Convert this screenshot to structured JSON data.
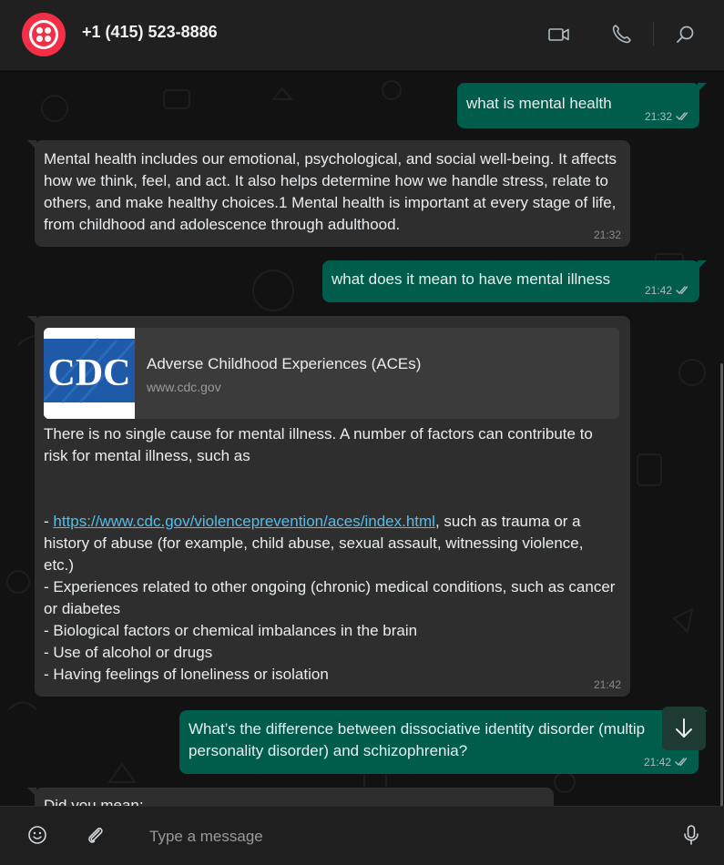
{
  "header": {
    "contact_name": "+1 (415) 523-8886",
    "icons": [
      "twilio-logo",
      "video-call-icon",
      "phone-icon",
      "search-icon"
    ]
  },
  "messages": [
    {
      "direction": "outgoing",
      "text": "what is mental health",
      "time": "21:32",
      "status": "read"
    },
    {
      "direction": "incoming",
      "text": "Mental health includes our emotional, psychological, and social well-being. It affects how we think, feel, and act. It also helps determine how we handle stress, relate to others, and make healthy choices.1 Mental health is important at every stage of life, from childhood and adolescence through adulthood.",
      "time": "21:32"
    },
    {
      "direction": "outgoing",
      "text": "what does it mean to have mental illness",
      "time": "21:42",
      "status": "read"
    },
    {
      "direction": "incoming",
      "link_preview": {
        "logo_text": "CDC",
        "title": "Adverse Childhood Experiences (ACEs)",
        "domain": "www.cdc.gov"
      },
      "intro": "There is no single cause for mental illness. A number of factors can contribute to risk for mental illness, such as",
      "link_prefix": "- ",
      "link_url": "https://www.cdc.gov/violenceprevention/aces/index.html",
      "after_link": ", such as trauma or a history of abuse (for example, child abuse, sexual assault, witnessing violence, etc.)\n- Experiences related to other ongoing (chronic) medical conditions, such as cancer or diabetes\n- Biological factors or chemical imbalances in the brain\n- Use of alcohol or drugs\n- Having feelings of loneliness or isolation",
      "time": "21:42"
    },
    {
      "direction": "outgoing",
      "text": "What’s the difference between dissociative identity disorder (multip personality disorder) and schizophrenia?",
      "time": "21:42",
      "status": "read"
    },
    {
      "direction": "incoming",
      "text": "Did you mean:",
      "partial": true
    }
  ],
  "composer": {
    "placeholder": "Type a message",
    "icons": [
      "emoji-icon",
      "attach-icon",
      "microphone-icon"
    ]
  },
  "colors": {
    "outgoing_bubble": "#005c4b",
    "incoming_bubble": "#2e2e2e",
    "header_bg": "#202020",
    "chat_bg": "#121212",
    "link": "#53bdeb",
    "brand": "#f22f46"
  }
}
